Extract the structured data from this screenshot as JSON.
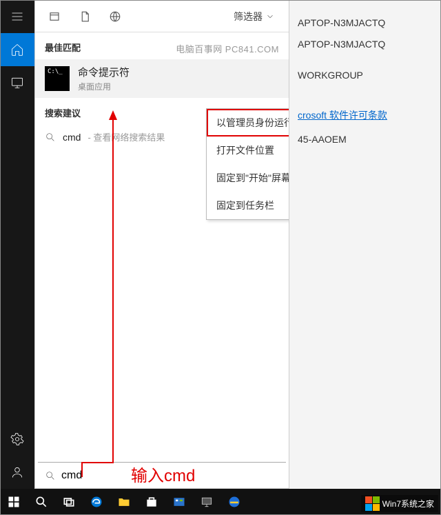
{
  "sidebar": {
    "items": [
      {
        "name": "menu"
      },
      {
        "name": "home",
        "active": true
      },
      {
        "name": "display"
      },
      {
        "name": "settings"
      },
      {
        "name": "user"
      }
    ]
  },
  "panel": {
    "filter_label": "筛选器",
    "watermark": "电脑百事网 PC841.COM",
    "sections": {
      "best": "最佳匹配",
      "suggest": "搜索建议"
    },
    "best_match": {
      "title": "命令提示符",
      "subtitle": "桌面应用",
      "tile_text": "C:\\_"
    },
    "context_menu": [
      "以管理员身份运行",
      "打开文件位置",
      "固定到\"开始\"屏幕",
      "固定到任务栏"
    ],
    "suggestion": {
      "keyword": "cmd",
      "desc": " - 查看网络搜索结果"
    },
    "search_value": "cmd"
  },
  "annotation": {
    "label": "输入cmd"
  },
  "background_window": {
    "lines": [
      "APTOP-N3MJACTQ",
      "APTOP-N3MJACTQ",
      "WORKGROUP"
    ],
    "link": "crosoft 软件许可条款",
    "tail": "45-AAOEM"
  },
  "taskbar": {
    "watermark": "Win7系统之家"
  }
}
